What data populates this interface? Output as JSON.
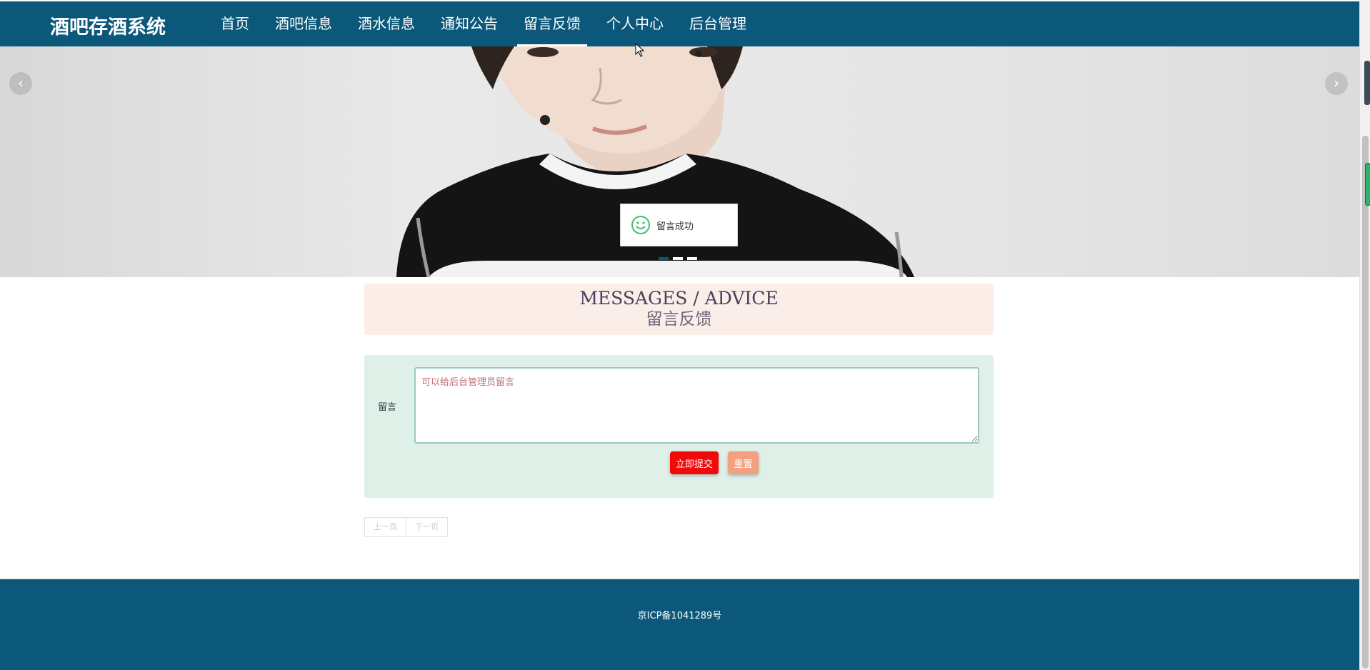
{
  "header": {
    "logo": "酒吧存酒系统",
    "nav": [
      {
        "label": "首页",
        "name": "nav-home"
      },
      {
        "label": "酒吧信息",
        "name": "nav-bar-info"
      },
      {
        "label": "酒水信息",
        "name": "nav-drink-info"
      },
      {
        "label": "通知公告",
        "name": "nav-notices"
      },
      {
        "label": "留言反馈",
        "name": "nav-feedback",
        "active": true
      },
      {
        "label": "个人中心",
        "name": "nav-profile"
      },
      {
        "label": "后台管理",
        "name": "nav-admin"
      }
    ]
  },
  "banner": {
    "prev_icon": "chevron-left-icon",
    "next_icon": "chevron-right-icon",
    "slide_count": 3,
    "active_slide": 0
  },
  "toast": {
    "icon": "smile-icon",
    "message": "留言成功"
  },
  "section": {
    "title_en": "MESSAGES / ADVICE",
    "title_cn": "留言反馈"
  },
  "form": {
    "label": "留言",
    "placeholder": "可以给后台管理员留言",
    "value": "",
    "submit_label": "立即提交",
    "reset_label": "重置"
  },
  "pager": {
    "prev_label": "上一页",
    "next_label": "下一页"
  },
  "footer": {
    "icp": "京ICP备1041289号"
  },
  "colors": {
    "primary": "#0b587a",
    "title_bg": "#fbeee8",
    "form_bg": "#def0e8",
    "submit": "#f00a0a",
    "reset": "#f2a07f"
  }
}
